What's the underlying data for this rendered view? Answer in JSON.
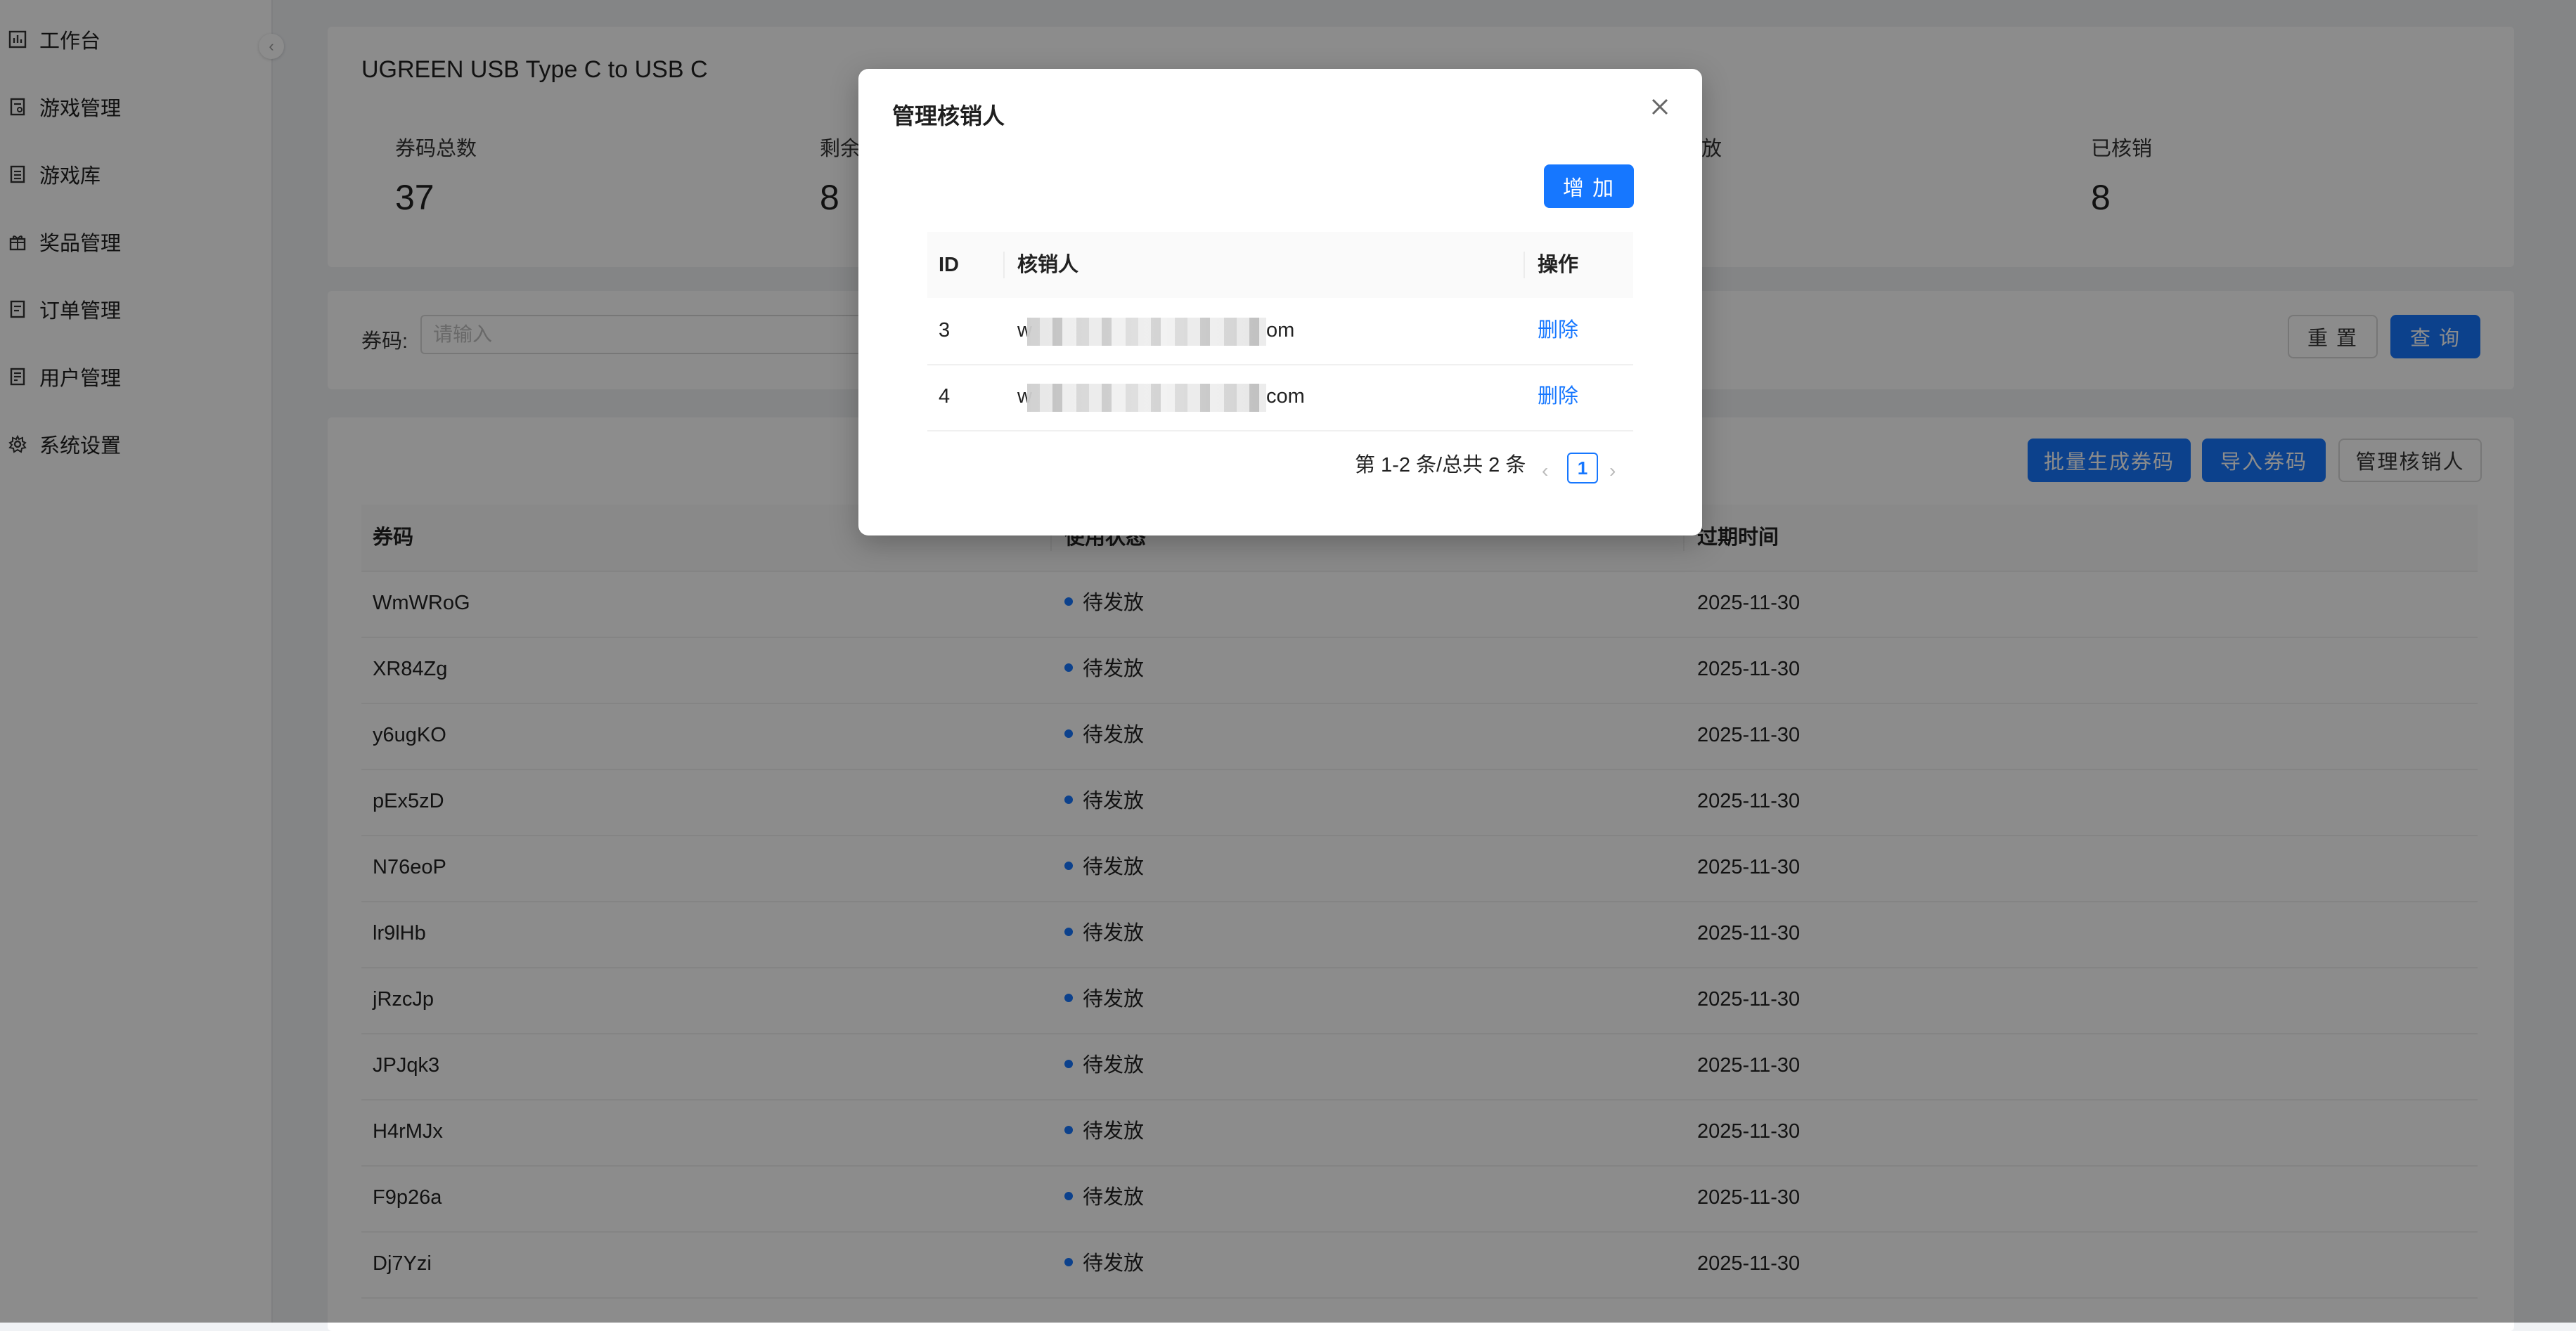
{
  "sidebar": {
    "items": [
      {
        "label": "工作台",
        "icon": "dashboard-icon"
      },
      {
        "label": "游戏管理",
        "icon": "game-doc-icon"
      },
      {
        "label": "游戏库",
        "icon": "library-icon"
      },
      {
        "label": "奖品管理",
        "icon": "gift-icon"
      },
      {
        "label": "订单管理",
        "icon": "order-icon"
      },
      {
        "label": "用户管理",
        "icon": "user-doc-icon"
      },
      {
        "label": "系统设置",
        "icon": "gear-icon"
      }
    ],
    "collapse_icon": "chevron-left-icon"
  },
  "product": {
    "title": "UGREEN USB Type C to USB C",
    "stats": [
      {
        "label": "券码总数",
        "value": "37"
      },
      {
        "label": "剩余",
        "value": "8"
      },
      {
        "label": "放",
        "value": ""
      },
      {
        "label": "已核销",
        "value": "8"
      }
    ]
  },
  "search": {
    "label": "券码:",
    "placeholder": "请输入",
    "reset_label": "重 置",
    "query_label": "查 询"
  },
  "actions": {
    "batch_generate_label": "批量生成券码",
    "import_label": "导入券码",
    "manage_label": "管理核销人"
  },
  "table": {
    "columns": [
      "券码",
      "使用状态",
      "过期时间"
    ],
    "rows": [
      {
        "code": "WmWRoG",
        "status": "待发放",
        "expiry": "2025-11-30"
      },
      {
        "code": "XR84Zg",
        "status": "待发放",
        "expiry": "2025-11-30"
      },
      {
        "code": "y6ugKO",
        "status": "待发放",
        "expiry": "2025-11-30"
      },
      {
        "code": "pEx5zD",
        "status": "待发放",
        "expiry": "2025-11-30"
      },
      {
        "code": "N76eoP",
        "status": "待发放",
        "expiry": "2025-11-30"
      },
      {
        "code": "lr9lHb",
        "status": "待发放",
        "expiry": "2025-11-30"
      },
      {
        "code": "jRzcJp",
        "status": "待发放",
        "expiry": "2025-11-30"
      },
      {
        "code": "JPJqk3",
        "status": "待发放",
        "expiry": "2025-11-30"
      },
      {
        "code": "H4rMJx",
        "status": "待发放",
        "expiry": "2025-11-30"
      },
      {
        "code": "F9p26a",
        "status": "待发放",
        "expiry": "2025-11-30"
      },
      {
        "code": "Dj7Yzi",
        "status": "待发放",
        "expiry": "2025-11-30"
      }
    ],
    "status_color": "#1677ff"
  },
  "modal": {
    "title": "管理核销人",
    "add_label": "增 加",
    "columns": [
      "ID",
      "核销人",
      "操作"
    ],
    "rows": [
      {
        "id": "3",
        "prefix": "w",
        "suffix": "om",
        "action": "删除"
      },
      {
        "id": "4",
        "prefix": "w",
        "suffix": "com",
        "action": "删除"
      }
    ],
    "pagination_text": "第 1-2 条/总共 2 条",
    "current_page": "1",
    "close_icon": "close-icon"
  },
  "colors": {
    "primary": "#1677ff",
    "overlay": "rgba(0,0,0,0.45)"
  }
}
